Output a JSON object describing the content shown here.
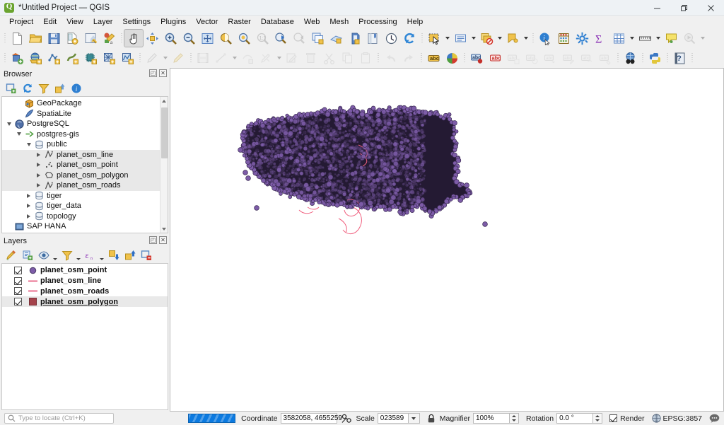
{
  "window": {
    "title": "*Untitled Project — QGIS",
    "app_icon": "qgis-logo-icon",
    "minimize_label": "—",
    "maximize_label": "❐",
    "close_label": "✕"
  },
  "menubar": {
    "items": [
      {
        "label": "Project"
      },
      {
        "label": "Edit"
      },
      {
        "label": "View"
      },
      {
        "label": "Layer"
      },
      {
        "label": "Settings"
      },
      {
        "label": "Plugins"
      },
      {
        "label": "Vector"
      },
      {
        "label": "Raster"
      },
      {
        "label": "Database"
      },
      {
        "label": "Web"
      },
      {
        "label": "Mesh"
      },
      {
        "label": "Processing"
      },
      {
        "label": "Help"
      }
    ]
  },
  "toolbar_top": {
    "buttons": [
      {
        "name": "new-project-button",
        "tip": "New Project"
      },
      {
        "name": "open-project-button",
        "tip": "Open Project"
      },
      {
        "name": "save-project-button",
        "tip": "Save Project"
      },
      {
        "name": "save-project-as-button",
        "tip": "Save Project As"
      },
      {
        "name": "new-print-layout-button",
        "tip": "New Print Layout"
      },
      {
        "name": "style-manager-button",
        "tip": "Style Manager"
      },
      {
        "name": "pan-map-button",
        "tip": "Pan Map",
        "active": true
      },
      {
        "name": "pan-to-selection-button",
        "tip": "Pan Map to Selection"
      },
      {
        "name": "zoom-in-button",
        "tip": "Zoom In"
      },
      {
        "name": "zoom-out-button",
        "tip": "Zoom Out"
      },
      {
        "name": "zoom-full-button",
        "tip": "Zoom Full"
      },
      {
        "name": "zoom-to-selection-button",
        "tip": "Zoom to Selection"
      },
      {
        "name": "zoom-to-layer-button",
        "tip": "Zoom to Layer"
      },
      {
        "name": "zoom-native-button",
        "tip": "Zoom to Native Resolution",
        "disabled": true
      },
      {
        "name": "zoom-last-button",
        "tip": "Zoom Last"
      },
      {
        "name": "zoom-next-button",
        "tip": "Zoom Next",
        "disabled": true
      },
      {
        "name": "new-map-view-button",
        "tip": "New Map View"
      },
      {
        "name": "new-3d-map-view-button",
        "tip": "New 3D Map View"
      },
      {
        "name": "identify-results-button",
        "tip": "Show Map Tips"
      },
      {
        "name": "measure-button",
        "tip": "Measure Line"
      },
      {
        "name": "bookmarks-button",
        "tip": "Show Bookmarks"
      },
      {
        "name": "temporal-controller-button",
        "tip": "Temporal Controller"
      },
      {
        "name": "refresh-button",
        "tip": "Refresh"
      },
      {
        "name": "select-features-button",
        "tip": "Select Features"
      },
      {
        "name": "select-value-button",
        "tip": "Select Features by Value"
      },
      {
        "name": "deselect-features-button",
        "tip": "Deselect Features"
      },
      {
        "name": "identify-features-button",
        "tip": "Identify Features"
      },
      {
        "name": "open-field-calculator-button",
        "tip": "Field Calculator"
      },
      {
        "name": "statistical-summary-button",
        "tip": "Statistical Summary"
      },
      {
        "name": "open-attribute-table-button",
        "tip": "Open Attribute Table"
      },
      {
        "name": "measure-line-button",
        "tip": "Measure"
      },
      {
        "name": "map-tips-button",
        "tip": "Map Tips"
      },
      {
        "name": "run-feature-action-button",
        "tip": "Run Feature Action",
        "disabled": true
      }
    ]
  },
  "toolbar_second": {
    "buttons": [
      {
        "name": "open-data-source-manager-button",
        "tip": "Open Data Source Manager"
      },
      {
        "name": "add-vector-layer-button",
        "tip": "Add Vector Layer"
      },
      {
        "name": "add-raster-layer-button",
        "tip": "Add Raster Layer"
      },
      {
        "name": "add-mesh-layer-button",
        "tip": "Add Mesh Layer"
      },
      {
        "name": "add-delimited-text-layer-button",
        "tip": "Add Delimited Text Layer"
      },
      {
        "name": "add-postgis-layer-button",
        "tip": "Add PostGIS Layer"
      },
      {
        "name": "add-wms-layer-button",
        "tip": "Add WMS Layer"
      },
      {
        "name": "current-edits-button",
        "tip": "Current Edits",
        "disabled": true
      },
      {
        "name": "toggle-editing-button",
        "tip": "Toggle Editing",
        "disabled": true
      },
      {
        "name": "save-layer-edits-button",
        "tip": "Save Layer Edits",
        "disabled": true
      },
      {
        "name": "add-feature-button",
        "tip": "Add Feature",
        "disabled": true
      },
      {
        "name": "vertex-tool-button",
        "tip": "Vertex Tool",
        "disabled": true
      },
      {
        "name": "modify-attributes-button",
        "tip": "Modify Attributes of Features",
        "disabled": true
      },
      {
        "name": "delete-selected-button",
        "tip": "Delete Selected",
        "disabled": true
      },
      {
        "name": "cut-features-button",
        "tip": "Cut Features",
        "disabled": true
      },
      {
        "name": "copy-features-button",
        "tip": "Copy Features",
        "disabled": true
      },
      {
        "name": "paste-features-button",
        "tip": "Paste Features",
        "disabled": true
      },
      {
        "name": "undo-button",
        "tip": "Undo",
        "disabled": true
      },
      {
        "name": "redo-button",
        "tip": "Redo",
        "disabled": true
      },
      {
        "name": "layer-labeling-button",
        "tip": "Layer Labeling Options"
      },
      {
        "name": "layer-diagram-button",
        "tip": "Layer Diagram Options"
      },
      {
        "name": "highlight-pinned-labels-button",
        "tip": "Highlight Pinned Labels"
      },
      {
        "name": "pin-labels-button",
        "tip": "Pin/Unpin Labels"
      },
      {
        "name": "show-hide-labels-button",
        "tip": "Show/Hide Labels",
        "disabled": true
      },
      {
        "name": "move-label-button",
        "tip": "Move Label",
        "disabled": true
      },
      {
        "name": "rotate-label-button",
        "tip": "Rotate Label",
        "disabled": true
      },
      {
        "name": "change-label-button",
        "tip": "Change Label",
        "disabled": true
      },
      {
        "name": "rotate-label2-button",
        "tip": "Rotate Label",
        "disabled": true
      },
      {
        "name": "revert-label-button",
        "tip": "Revert Label",
        "disabled": true
      },
      {
        "name": "metasearch-button",
        "tip": "MetaSearch"
      },
      {
        "name": "python-console-button",
        "tip": "Python Console"
      },
      {
        "name": "help-button",
        "tip": "Help"
      }
    ]
  },
  "browser_panel": {
    "title": "Browser",
    "undock_label": "◰",
    "close_label": "✕",
    "toolbar": [
      {
        "name": "add-selected-layers-button",
        "tip": "Add Selected Layers"
      },
      {
        "name": "refresh-browser-button",
        "tip": "Refresh"
      },
      {
        "name": "filter-browser-button",
        "tip": "Filter Browser"
      },
      {
        "name": "collapse-all-button",
        "tip": "Collapse All"
      },
      {
        "name": "browser-properties-button",
        "tip": "Properties"
      }
    ],
    "tree": [
      {
        "label": "GeoPackage",
        "indent": 1,
        "twist": "none",
        "icon": "geopackage-icon",
        "selected": false
      },
      {
        "label": "SpatiaLite",
        "indent": 1,
        "twist": "none",
        "icon": "spatialite-icon",
        "selected": false
      },
      {
        "label": "PostgreSQL",
        "indent": 0,
        "twist": "open",
        "icon": "postgresql-icon",
        "selected": false
      },
      {
        "label": "postgres-gis",
        "indent": 1,
        "twist": "open",
        "icon": "connection-icon",
        "selected": false
      },
      {
        "label": "public",
        "indent": 2,
        "twist": "open",
        "icon": "schema-icon",
        "selected": false
      },
      {
        "label": "planet_osm_line",
        "indent": 3,
        "twist": "closed",
        "icon": "line-layer-icon",
        "selected": true
      },
      {
        "label": "planet_osm_point",
        "indent": 3,
        "twist": "closed",
        "icon": "point-layer-icon",
        "selected": true
      },
      {
        "label": "planet_osm_polygon",
        "indent": 3,
        "twist": "closed",
        "icon": "polygon-layer-icon",
        "selected": true
      },
      {
        "label": "planet_osm_roads",
        "indent": 3,
        "twist": "closed",
        "icon": "line-layer-icon",
        "selected": true
      },
      {
        "label": "tiger",
        "indent": 2,
        "twist": "closed",
        "icon": "schema-icon",
        "selected": false
      },
      {
        "label": "tiger_data",
        "indent": 2,
        "twist": "closed",
        "icon": "schema-icon",
        "selected": false
      },
      {
        "label": "topology",
        "indent": 2,
        "twist": "closed",
        "icon": "schema-icon",
        "selected": false
      },
      {
        "label": "SAP HANA",
        "indent": 0,
        "twist": "none",
        "icon": "saphana-icon",
        "selected": false
      }
    ]
  },
  "layers_panel": {
    "title": "Layers",
    "undock_label": "◰",
    "close_label": "✕",
    "toolbar": [
      {
        "name": "open-layer-styling-panel-button",
        "tip": "Open the Layer Styling panel"
      },
      {
        "name": "add-group-button",
        "tip": "Add Group"
      },
      {
        "name": "manage-map-themes-button",
        "tip": "Manage Map Themes"
      },
      {
        "name": "filter-legend-button",
        "tip": "Filter Legend"
      },
      {
        "name": "filter-legend-expression-button",
        "tip": "Filter Legend by Expression"
      },
      {
        "name": "expand-all-button",
        "tip": "Expand All"
      },
      {
        "name": "collapse-all-layers-button",
        "tip": "Collapse All"
      },
      {
        "name": "remove-layer-button",
        "tip": "Remove Layer/Group"
      }
    ],
    "layers": [
      {
        "name": "planet_osm_point",
        "checked": true,
        "symbol": "point",
        "color": "#7d5ca8",
        "selected": false,
        "underline": false
      },
      {
        "name": "planet_osm_line",
        "checked": true,
        "symbol": "line",
        "color": "#e8708f",
        "selected": false,
        "underline": false
      },
      {
        "name": "planet_osm_roads",
        "checked": true,
        "symbol": "line",
        "color": "#e8708f",
        "selected": false,
        "underline": false
      },
      {
        "name": "planet_osm_polygon",
        "checked": true,
        "symbol": "polygon",
        "color": "#a4434b",
        "selected": true,
        "underline": true
      }
    ]
  },
  "map": {
    "background": "#ffffff",
    "point_color": "#7d5ca8",
    "point_stroke": "#3a2a52",
    "line_color": "#f0607f",
    "description": "Dense purple point cloud covering the outline of Romania with pink road lines"
  },
  "statusbar": {
    "locate_placeholder": "Type to locate (Ctrl+K)",
    "locate_value": "",
    "search_icon": "search-icon",
    "progress_visible": true,
    "coordinate_label": "Coordinate",
    "coordinate_value": "3582058, 4655259",
    "toggle_extents_icon": "toggle-extents-icon",
    "scale_label": "Scale",
    "scale_value": "023589",
    "lock_icon": "lock-icon",
    "magnifier_label": "Magnifier",
    "magnifier_value": "100%",
    "rotation_label": "Rotation",
    "rotation_value": "0.0 °",
    "render_label": "Render",
    "render_checked": true,
    "crs_label": "EPSG:3857",
    "crs_icon": "globe-icon",
    "messages_icon": "message-bubble-icon"
  }
}
